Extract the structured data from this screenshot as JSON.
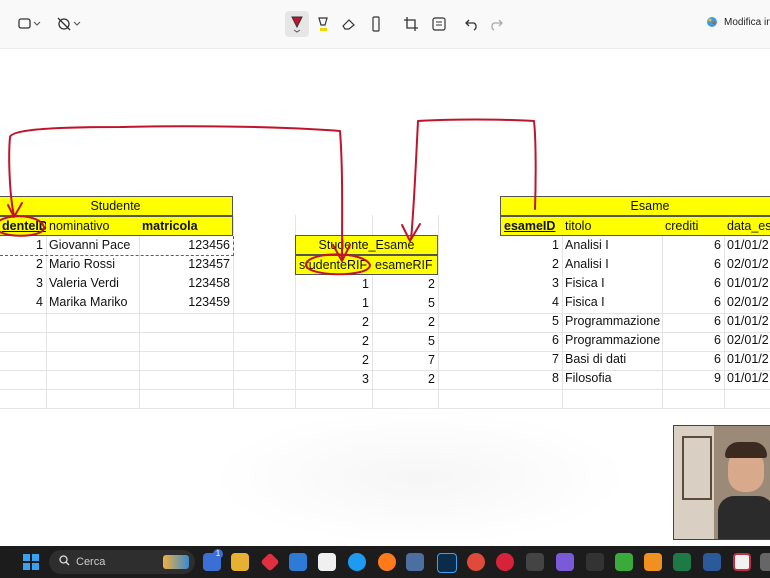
{
  "toolbar": {
    "modifica_label": "Modifica in",
    "icons": [
      "rectangle-select-icon",
      "chevron-down-icon",
      "timer-off-icon",
      "chevron-down-icon",
      "pen-icon",
      "highlighter-icon",
      "eraser-icon",
      "ruler-icon",
      "crop-icon",
      "text-extract-icon",
      "undo-icon",
      "redo-icon",
      "paint-icon"
    ]
  },
  "tables": {
    "studente": {
      "title": "Studente",
      "headers": [
        "denteID",
        "nominativo",
        "matricola"
      ],
      "rows": [
        [
          "1",
          "Giovanni Pace",
          "123456"
        ],
        [
          "2",
          "Mario Rossi",
          "123457"
        ],
        [
          "3",
          "Valeria Verdi",
          "123458"
        ],
        [
          "4",
          "Marika Mariko",
          "123459"
        ]
      ]
    },
    "studente_esame": {
      "title": "Studente_Esame",
      "headers": [
        "studenteRIF",
        "esameRIF"
      ],
      "rows": [
        [
          "1",
          "2"
        ],
        [
          "1",
          "5"
        ],
        [
          "2",
          "2"
        ],
        [
          "2",
          "5"
        ],
        [
          "2",
          "7"
        ],
        [
          "3",
          "2"
        ]
      ]
    },
    "esame": {
      "title": "Esame",
      "headers": [
        "esameID",
        "titolo",
        "crediti",
        "data_es"
      ],
      "rows": [
        [
          "1",
          "Analisi I",
          "6",
          "01/01/2"
        ],
        [
          "2",
          "Analisi I",
          "6",
          "02/01/2"
        ],
        [
          "3",
          "Fisica I",
          "6",
          "01/01/2"
        ],
        [
          "4",
          "Fisica I",
          "6",
          "02/01/2"
        ],
        [
          "5",
          "Programmazione",
          "6",
          "01/01/2"
        ],
        [
          "6",
          "Programmazione",
          "6",
          "02/01/2"
        ],
        [
          "7",
          "Basi di dati",
          "6",
          "01/01/2"
        ],
        [
          "8",
          "Filosofia",
          "9",
          "01/01/2"
        ]
      ]
    }
  },
  "annotations": {
    "ink_color": "#c0142c"
  },
  "taskbar": {
    "search_placeholder": "Cerca",
    "badge_count": "1"
  }
}
